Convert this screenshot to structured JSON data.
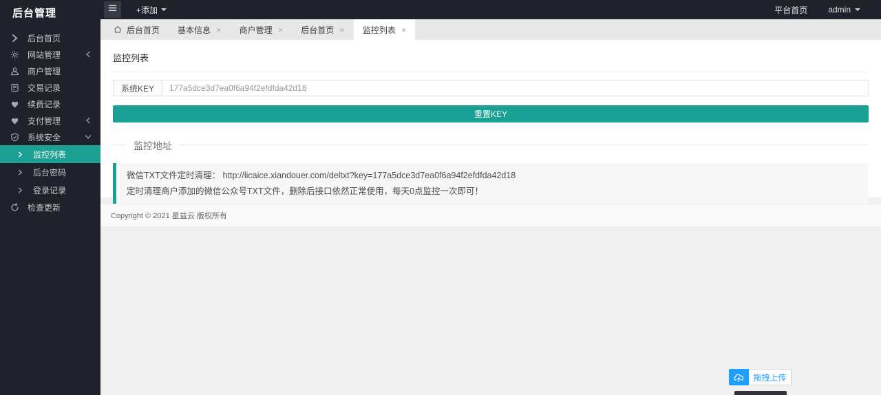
{
  "app": {
    "title": "后台管理"
  },
  "topbar": {
    "add_label": "+添加",
    "platform_link": "平台首页",
    "user": "admin"
  },
  "tabs": [
    {
      "id": "home",
      "label": "后台首页",
      "home": true,
      "closable": false,
      "active": false
    },
    {
      "id": "basic-info",
      "label": "基本信息",
      "home": false,
      "closable": true,
      "active": false
    },
    {
      "id": "merchant-manage",
      "label": "商户管理",
      "home": false,
      "closable": true,
      "active": false
    },
    {
      "id": "admin-home",
      "label": "后台首页",
      "home": false,
      "closable": true,
      "active": false
    },
    {
      "id": "monitor-list",
      "label": "监控列表",
      "home": false,
      "closable": true,
      "active": true
    }
  ],
  "sidebar": {
    "items": [
      {
        "id": "admin-home",
        "label": "后台首页",
        "icon": "chevron-right-icon"
      },
      {
        "id": "site-manage",
        "label": "网站管理",
        "icon": "gear-icon",
        "state": "collapsed"
      },
      {
        "id": "merchant-manage",
        "label": "商户管理",
        "icon": "user-icon"
      },
      {
        "id": "trade-records",
        "label": "交易记录",
        "icon": "document-icon"
      },
      {
        "id": "renew-records",
        "label": "续费记录",
        "icon": "heart-icon"
      },
      {
        "id": "payment-manage",
        "label": "支付管理",
        "icon": "heart-icon",
        "state": "collapsed"
      },
      {
        "id": "system-security",
        "label": "系统安全",
        "icon": "shield-icon",
        "state": "expanded",
        "children": [
          {
            "id": "monitor-list",
            "label": "监控列表",
            "active": true
          },
          {
            "id": "admin-password",
            "label": "后台密码",
            "active": false
          },
          {
            "id": "login-records",
            "label": "登录记录",
            "active": false
          }
        ]
      },
      {
        "id": "check-update",
        "label": "检查更新",
        "icon": "refresh-icon"
      }
    ]
  },
  "content": {
    "page_title": "监控列表",
    "form": {
      "key_label": "系统KEY",
      "key_value": "177a5dce3d7ea0f6a94f2efdfda42d18"
    },
    "reset_button": "重置KEY",
    "section_title": "监控地址",
    "notice_line1": "微信TXT文件定时清理： http://licaice.xiandouer.com/deltxt?key=177a5dce3d7ea0f6a94f2efdfda42d18",
    "notice_line2": "定时清理商户添加的微信公众号TXT文件，删除后接口依然正常使用，每天0点监控一次即可！"
  },
  "footer": {
    "copyright": "Copyright © 2021 星益云 版权所有"
  },
  "upload": {
    "label": "拖拽上传"
  },
  "colors": {
    "accent": "#1aa094",
    "upload_blue": "#1E9FFF",
    "dark": "#20222b"
  }
}
